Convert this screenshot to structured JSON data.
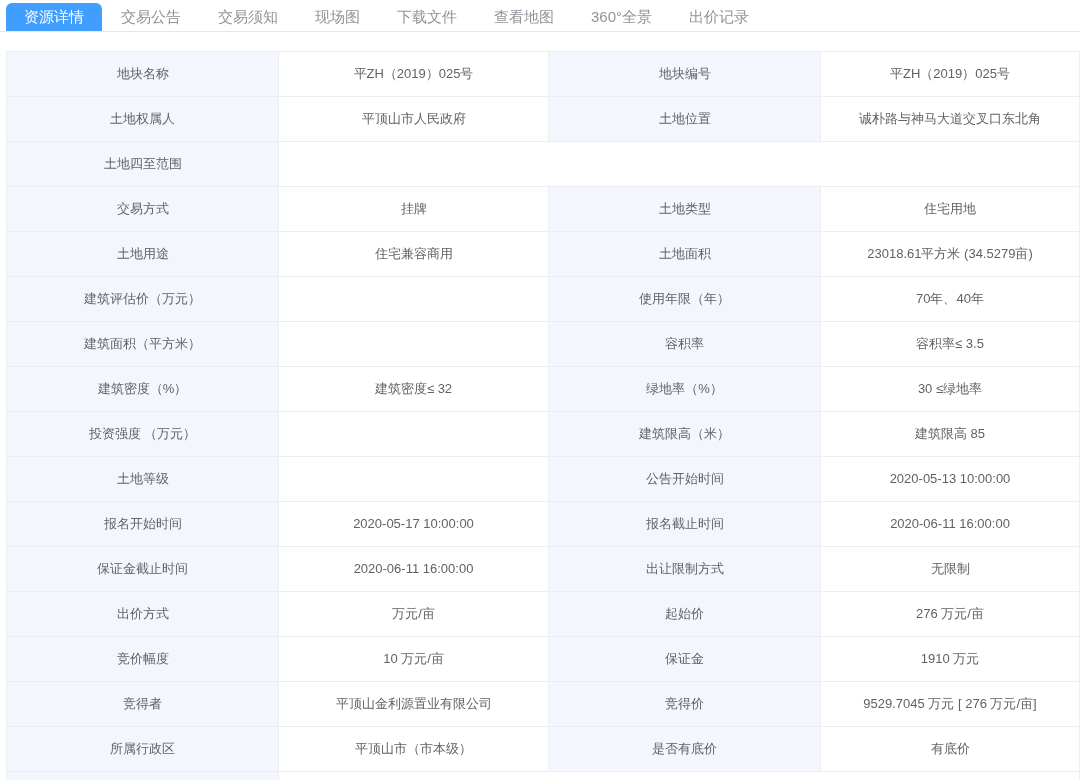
{
  "tabs": [
    {
      "label": "资源详情",
      "selected": true
    },
    {
      "label": "交易公告",
      "selected": false
    },
    {
      "label": "交易须知",
      "selected": false
    },
    {
      "label": "现场图",
      "selected": false
    },
    {
      "label": "下载文件",
      "selected": false
    },
    {
      "label": "查看地图",
      "selected": false
    },
    {
      "label": "360°全景",
      "selected": false
    },
    {
      "label": "出价记录",
      "selected": false
    }
  ],
  "rows": [
    {
      "kind": "pair",
      "cells": [
        {
          "label": "地块名称",
          "value": "平ZH（2019）025号"
        },
        {
          "label": "地块编号",
          "value": "平ZH（2019）025号"
        }
      ]
    },
    {
      "kind": "pair",
      "cells": [
        {
          "label": "土地权属人",
          "value": "平顶山市人民政府"
        },
        {
          "label": "土地位置",
          "value": "诚朴路与神马大道交叉口东北角"
        }
      ]
    },
    {
      "kind": "wide",
      "cells": [
        {
          "label": "土地四至范围"
        }
      ]
    },
    {
      "kind": "pair",
      "cells": [
        {
          "label": "交易方式",
          "value": "挂牌"
        },
        {
          "label": "土地类型",
          "value": "住宅用地"
        }
      ]
    },
    {
      "kind": "pair",
      "cells": [
        {
          "label": "土地用途",
          "value": "住宅兼容商用"
        },
        {
          "label": "土地面积",
          "value": "23018.61平方米 (34.5279亩)"
        }
      ]
    },
    {
      "kind": "pair",
      "cells": [
        {
          "label": "建筑评估价（万元）"
        },
        {
          "label": "使用年限（年）",
          "value": "70年、40年"
        }
      ]
    },
    {
      "kind": "pair",
      "cells": [
        {
          "label": "建筑面积（平方米）"
        },
        {
          "label": "容积率",
          "value": "容积率≤ 3.5"
        }
      ]
    },
    {
      "kind": "pair",
      "cells": [
        {
          "label": "建筑密度（%）",
          "value": "建筑密度≤ 32"
        },
        {
          "label": "绿地率（%）",
          "value": "30 ≤绿地率"
        }
      ]
    },
    {
      "kind": "pair",
      "cells": [
        {
          "label": "投资强度 （万元）"
        },
        {
          "label": "建筑限高（米）",
          "value": "建筑限高 85"
        }
      ]
    },
    {
      "kind": "pair",
      "cells": [
        {
          "label": "土地等级"
        },
        {
          "label": "公告开始时间",
          "value": "2020-05-13 10:00:00"
        }
      ]
    },
    {
      "kind": "pair",
      "cells": [
        {
          "label": "报名开始时间",
          "value": "2020-05-17 10:00:00"
        },
        {
          "label": "报名截止时间",
          "value": "2020-06-11 16:00:00"
        }
      ]
    },
    {
      "kind": "pair",
      "cells": [
        {
          "label": "保证金截止时间",
          "value": "2020-06-11 16:00:00"
        },
        {
          "label": "出让限制方式",
          "value": "无限制"
        }
      ]
    },
    {
      "kind": "pair",
      "cells": [
        {
          "label": "出价方式",
          "value": "万元/亩"
        },
        {
          "label": "起始价",
          "value": "276 万元/亩"
        }
      ]
    },
    {
      "kind": "pair",
      "cells": [
        {
          "label": "竞价幅度",
          "value": "10 万元/亩"
        },
        {
          "label": "保证金",
          "value": "1910 万元"
        }
      ]
    },
    {
      "kind": "pair",
      "cells": [
        {
          "label": "竞得者",
          "value": "平顶山金利源置业有限公司"
        },
        {
          "label": "竞得价",
          "value": "9529.7045 万元 [ 276 万元/亩]"
        }
      ]
    },
    {
      "kind": "pair",
      "cells": [
        {
          "label": "所属行政区",
          "value": "平顶山市（市本级）"
        },
        {
          "label": "是否有底价",
          "value": "有底价"
        }
      ]
    }
  ]
}
